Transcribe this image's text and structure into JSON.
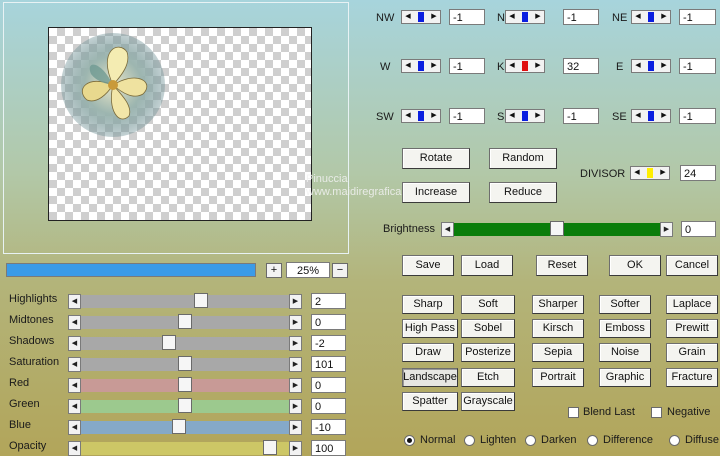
{
  "preview": {
    "watermark_line1": "Pinuccia",
    "watermark_line2": "www.maidiregrafica.eu"
  },
  "zoom": {
    "plus": "+",
    "value": "25%",
    "minus": "−"
  },
  "adjust": [
    {
      "label": "Highlights",
      "value": "2",
      "pos": 0.58,
      "color": "#a8a8a8"
    },
    {
      "label": "Midtones",
      "value": "0",
      "pos": 0.5,
      "color": "#a8a8a8"
    },
    {
      "label": "Shadows",
      "value": "-2",
      "pos": 0.42,
      "color": "#a8a8a8"
    },
    {
      "label": "Saturation",
      "value": "101",
      "pos": 0.5,
      "color": "#a8a8a8"
    },
    {
      "label": "Red",
      "value": "0",
      "pos": 0.5,
      "color": "#c89a96"
    },
    {
      "label": "Green",
      "value": "0",
      "pos": 0.5,
      "color": "#9cc98e"
    },
    {
      "label": "Blue",
      "value": "-10",
      "pos": 0.47,
      "color": "#85a9c8"
    },
    {
      "label": "Opacity",
      "value": "100",
      "pos": 0.94,
      "color": "#cdc766"
    }
  ],
  "kernel": [
    {
      "label": "NW",
      "value": "-1",
      "marker": "#0a1ee0"
    },
    {
      "label": "N",
      "value": "-1",
      "marker": "#0a1ee0"
    },
    {
      "label": "NE",
      "value": "-1",
      "marker": "#0a1ee0"
    },
    {
      "label": "W",
      "value": "-1",
      "marker": "#0a1ee0"
    },
    {
      "label": "K",
      "value": "32",
      "marker": "#e01010"
    },
    {
      "label": "E",
      "value": "-1",
      "marker": "#0a1ee0"
    },
    {
      "label": "SW",
      "value": "-1",
      "marker": "#0a1ee0"
    },
    {
      "label": "S",
      "value": "-1",
      "marker": "#0a1ee0"
    },
    {
      "label": "SE",
      "value": "-1",
      "marker": "#0a1ee0"
    }
  ],
  "buttons": {
    "rotate": "Rotate",
    "random": "Random",
    "increase": "Increase",
    "reduce": "Reduce",
    "save": "Save",
    "load": "Load",
    "reset": "Reset",
    "ok": "OK",
    "cancel": "Cancel"
  },
  "divisor": {
    "label": "DIVISOR",
    "value": "24",
    "marker": "#ffee00"
  },
  "brightness": {
    "label": "Brightness",
    "value": "0",
    "pos": 0.5,
    "color": "#0a7d0a"
  },
  "presets": [
    [
      "Sharp",
      "Soft",
      "Sharper",
      "Softer",
      "Laplace"
    ],
    [
      "High Pass",
      "Sobel",
      "Kirsch",
      "Emboss",
      "Prewitt"
    ],
    [
      "Draw",
      "Posterize",
      "Sepia",
      "Noise",
      "Grain"
    ],
    [
      "Landscape",
      "Etch",
      "Portrait",
      "Graphic",
      "Fracture"
    ],
    [
      "Spatter",
      "Grayscale"
    ]
  ],
  "blend_last": "Blend Last",
  "negative": "Negative",
  "modes": [
    "Normal",
    "Lighten",
    "Darken",
    "Difference",
    "Diffuse"
  ],
  "selected_mode": "Normal"
}
